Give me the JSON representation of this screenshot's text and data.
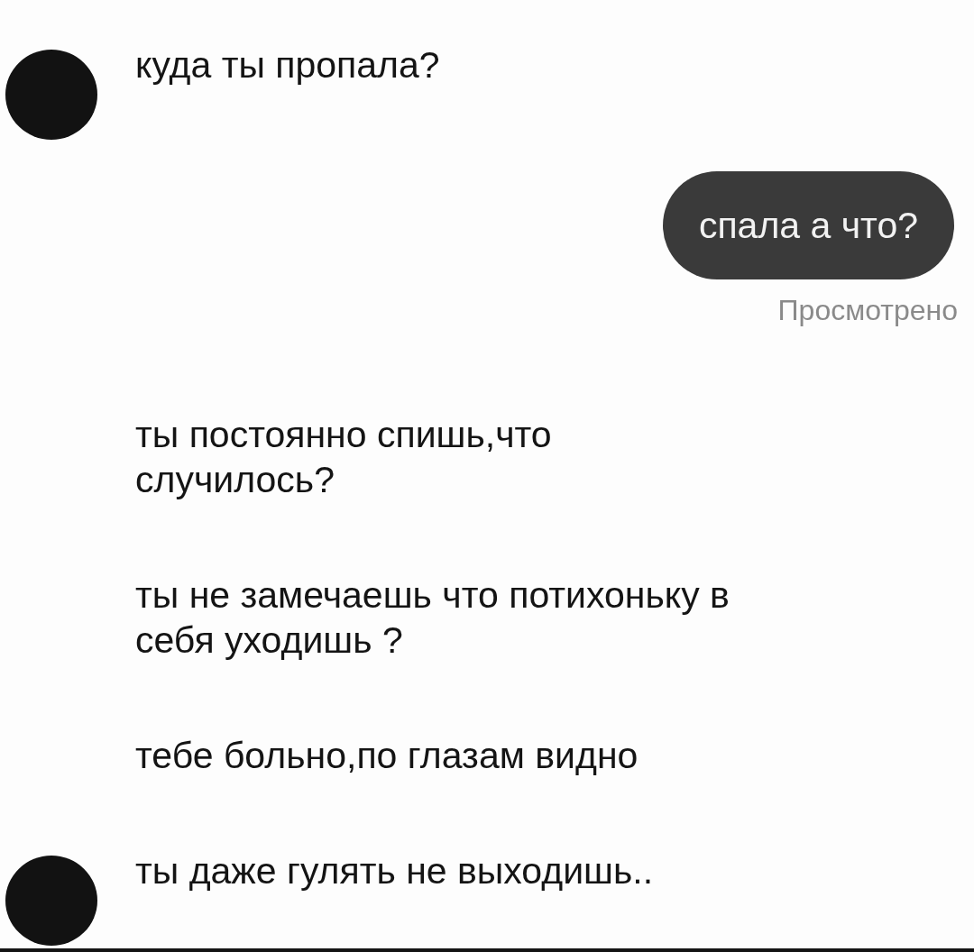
{
  "messages": [
    {
      "kind": "incoming",
      "avatar": true,
      "text": "куда ты пропала?"
    },
    {
      "kind": "outgoing",
      "text": "спала а что?",
      "seen_label": "Просмотрено"
    },
    {
      "kind": "incoming",
      "avatar": false,
      "text": "ты постоянно спишь,что случилось?"
    },
    {
      "kind": "incoming",
      "avatar": false,
      "text": "ты не замечаешь что потихоньку в себя уходишь ?"
    },
    {
      "kind": "incoming",
      "avatar": false,
      "text": "тебе больно,по глазам видно"
    },
    {
      "kind": "incoming",
      "avatar": true,
      "text": "ты даже гулять не выходишь.."
    }
  ]
}
